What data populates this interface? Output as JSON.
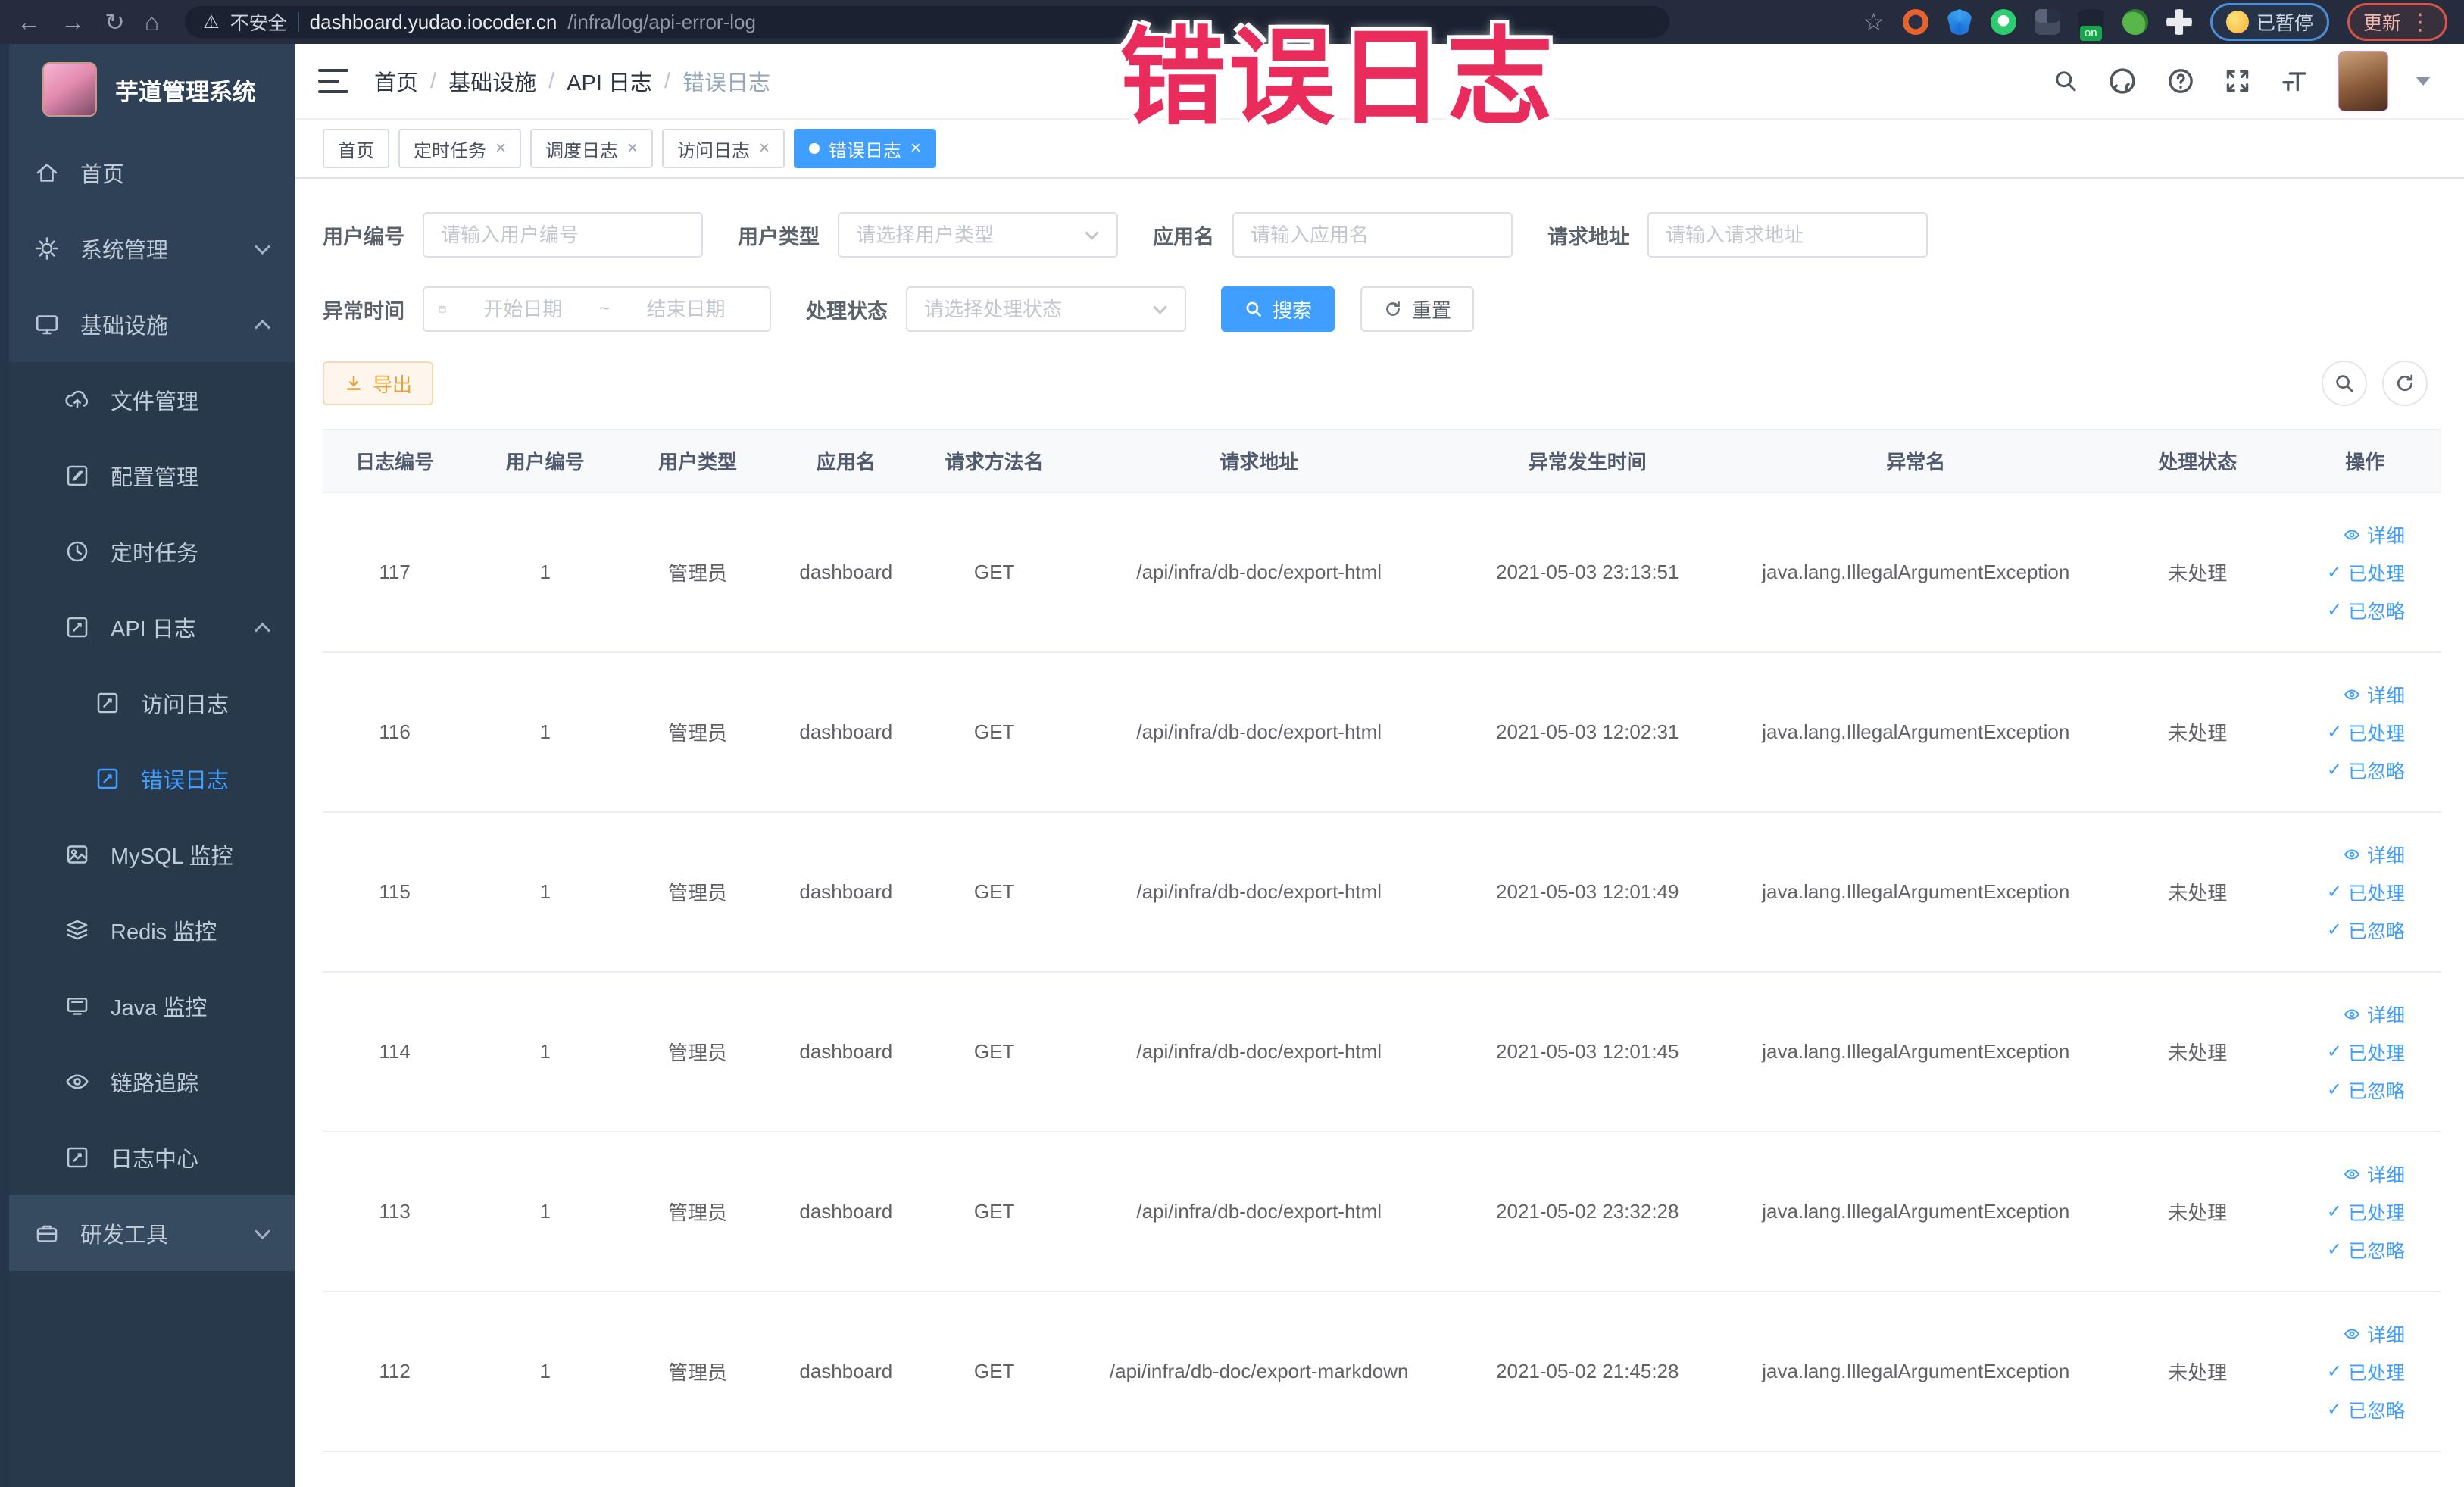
{
  "browser": {
    "security_label": "不安全",
    "url_host": "dashboard.yudao.iocoder.cn",
    "url_path": "/infra/log/api-error-log",
    "paused_badge": "已暂停",
    "update_button": "更新",
    "ext_on_badge": "on",
    "glyphs": {
      "back": "←",
      "forward": "→",
      "reload": "↻",
      "home": "⌂",
      "warning": "⚠",
      "star": "☆",
      "overflow": "⋮"
    }
  },
  "annotation": {
    "text": "错误日志",
    "color": "#ea2c5c"
  },
  "sidebar": {
    "title": "芋道管理系统",
    "menu": {
      "home": "首页",
      "system": "系统管理",
      "infra": "基础设施",
      "file": "文件管理",
      "config": "配置管理",
      "job": "定时任务",
      "api_log": "API 日志",
      "access_log": "访问日志",
      "error_log": "错误日志",
      "mysql": "MySQL 监控",
      "redis": "Redis 监控",
      "java": "Java 监控",
      "tracing": "链路追踪",
      "log_center": "日志中心",
      "devtools": "研发工具"
    }
  },
  "header": {
    "breadcrumbs": [
      "首页",
      "基础设施",
      "API 日志",
      "错误日志"
    ],
    "separator": "/"
  },
  "tabs": {
    "close_glyph": "×",
    "items": [
      {
        "label": "首页"
      },
      {
        "label": "定时任务"
      },
      {
        "label": "调度日志"
      },
      {
        "label": "访问日志"
      },
      {
        "label": "错误日志"
      }
    ]
  },
  "filters": {
    "user_id": {
      "label": "用户编号",
      "placeholder": "请输入用户编号"
    },
    "user_type": {
      "label": "用户类型",
      "placeholder": "请选择用户类型"
    },
    "app_name": {
      "label": "应用名",
      "placeholder": "请输入应用名"
    },
    "request_url": {
      "label": "请求地址",
      "placeholder": "请输入请求地址"
    },
    "exception_time": {
      "label": "异常时间",
      "start_placeholder": "开始日期",
      "separator": "~",
      "end_placeholder": "结束日期"
    },
    "process_status": {
      "label": "处理状态",
      "placeholder": "请选择处理状态"
    },
    "search_button": "搜索",
    "reset_button": "重置"
  },
  "toolbar": {
    "export_button": "导出"
  },
  "table": {
    "columns": [
      "日志编号",
      "用户编号",
      "用户类型",
      "应用名",
      "请求方法名",
      "请求地址",
      "异常发生时间",
      "异常名",
      "处理状态",
      "操作"
    ],
    "action_labels": {
      "detail": "详细",
      "processed": "已处理",
      "ignored": "已忽略",
      "check_glyph": "✓"
    },
    "rows": [
      {
        "id": "117",
        "user_id": "1",
        "user_type": "管理员",
        "app": "dashboard",
        "method": "GET",
        "url": "/api/infra/db-doc/export-html",
        "time": "2021-05-03 23:13:51",
        "exception": "java.lang.IllegalArgumentException",
        "status": "未处理"
      },
      {
        "id": "116",
        "user_id": "1",
        "user_type": "管理员",
        "app": "dashboard",
        "method": "GET",
        "url": "/api/infra/db-doc/export-html",
        "time": "2021-05-03 12:02:31",
        "exception": "java.lang.IllegalArgumentException",
        "status": "未处理"
      },
      {
        "id": "115",
        "user_id": "1",
        "user_type": "管理员",
        "app": "dashboard",
        "method": "GET",
        "url": "/api/infra/db-doc/export-html",
        "time": "2021-05-03 12:01:49",
        "exception": "java.lang.IllegalArgumentException",
        "status": "未处理"
      },
      {
        "id": "114",
        "user_id": "1",
        "user_type": "管理员",
        "app": "dashboard",
        "method": "GET",
        "url": "/api/infra/db-doc/export-html",
        "time": "2021-05-03 12:01:45",
        "exception": "java.lang.IllegalArgumentException",
        "status": "未处理"
      },
      {
        "id": "113",
        "user_id": "1",
        "user_type": "管理员",
        "app": "dashboard",
        "method": "GET",
        "url": "/api/infra/db-doc/export-html",
        "time": "2021-05-02 23:32:28",
        "exception": "java.lang.IllegalArgumentException",
        "status": "未处理"
      },
      {
        "id": "112",
        "user_id": "1",
        "user_type": "管理员",
        "app": "dashboard",
        "method": "GET",
        "url": "/api/infra/db-doc/export-markdown",
        "time": "2021-05-02 21:45:28",
        "exception": "java.lang.IllegalArgumentException",
        "status": "未处理"
      }
    ]
  },
  "colors": {
    "accent": "#409eff",
    "sidebar_bg": "#2e4156",
    "warning_text": "#e6a23c",
    "annotation_red": "#ea2c5c"
  }
}
